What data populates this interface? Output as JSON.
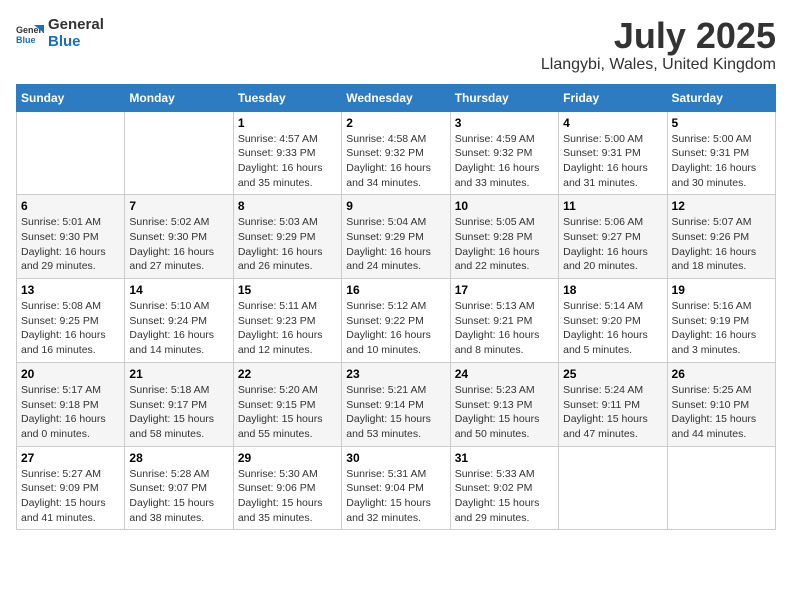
{
  "header": {
    "logo_general": "General",
    "logo_blue": "Blue",
    "main_title": "July 2025",
    "sub_title": "Llangybi, Wales, United Kingdom"
  },
  "weekdays": [
    "Sunday",
    "Monday",
    "Tuesday",
    "Wednesday",
    "Thursday",
    "Friday",
    "Saturday"
  ],
  "weeks": [
    [
      {
        "day": "",
        "detail": ""
      },
      {
        "day": "",
        "detail": ""
      },
      {
        "day": "1",
        "detail": "Sunrise: 4:57 AM\nSunset: 9:33 PM\nDaylight: 16 hours\nand 35 minutes."
      },
      {
        "day": "2",
        "detail": "Sunrise: 4:58 AM\nSunset: 9:32 PM\nDaylight: 16 hours\nand 34 minutes."
      },
      {
        "day": "3",
        "detail": "Sunrise: 4:59 AM\nSunset: 9:32 PM\nDaylight: 16 hours\nand 33 minutes."
      },
      {
        "day": "4",
        "detail": "Sunrise: 5:00 AM\nSunset: 9:31 PM\nDaylight: 16 hours\nand 31 minutes."
      },
      {
        "day": "5",
        "detail": "Sunrise: 5:00 AM\nSunset: 9:31 PM\nDaylight: 16 hours\nand 30 minutes."
      }
    ],
    [
      {
        "day": "6",
        "detail": "Sunrise: 5:01 AM\nSunset: 9:30 PM\nDaylight: 16 hours\nand 29 minutes."
      },
      {
        "day": "7",
        "detail": "Sunrise: 5:02 AM\nSunset: 9:30 PM\nDaylight: 16 hours\nand 27 minutes."
      },
      {
        "day": "8",
        "detail": "Sunrise: 5:03 AM\nSunset: 9:29 PM\nDaylight: 16 hours\nand 26 minutes."
      },
      {
        "day": "9",
        "detail": "Sunrise: 5:04 AM\nSunset: 9:29 PM\nDaylight: 16 hours\nand 24 minutes."
      },
      {
        "day": "10",
        "detail": "Sunrise: 5:05 AM\nSunset: 9:28 PM\nDaylight: 16 hours\nand 22 minutes."
      },
      {
        "day": "11",
        "detail": "Sunrise: 5:06 AM\nSunset: 9:27 PM\nDaylight: 16 hours\nand 20 minutes."
      },
      {
        "day": "12",
        "detail": "Sunrise: 5:07 AM\nSunset: 9:26 PM\nDaylight: 16 hours\nand 18 minutes."
      }
    ],
    [
      {
        "day": "13",
        "detail": "Sunrise: 5:08 AM\nSunset: 9:25 PM\nDaylight: 16 hours\nand 16 minutes."
      },
      {
        "day": "14",
        "detail": "Sunrise: 5:10 AM\nSunset: 9:24 PM\nDaylight: 16 hours\nand 14 minutes."
      },
      {
        "day": "15",
        "detail": "Sunrise: 5:11 AM\nSunset: 9:23 PM\nDaylight: 16 hours\nand 12 minutes."
      },
      {
        "day": "16",
        "detail": "Sunrise: 5:12 AM\nSunset: 9:22 PM\nDaylight: 16 hours\nand 10 minutes."
      },
      {
        "day": "17",
        "detail": "Sunrise: 5:13 AM\nSunset: 9:21 PM\nDaylight: 16 hours\nand 8 minutes."
      },
      {
        "day": "18",
        "detail": "Sunrise: 5:14 AM\nSunset: 9:20 PM\nDaylight: 16 hours\nand 5 minutes."
      },
      {
        "day": "19",
        "detail": "Sunrise: 5:16 AM\nSunset: 9:19 PM\nDaylight: 16 hours\nand 3 minutes."
      }
    ],
    [
      {
        "day": "20",
        "detail": "Sunrise: 5:17 AM\nSunset: 9:18 PM\nDaylight: 16 hours\nand 0 minutes."
      },
      {
        "day": "21",
        "detail": "Sunrise: 5:18 AM\nSunset: 9:17 PM\nDaylight: 15 hours\nand 58 minutes."
      },
      {
        "day": "22",
        "detail": "Sunrise: 5:20 AM\nSunset: 9:15 PM\nDaylight: 15 hours\nand 55 minutes."
      },
      {
        "day": "23",
        "detail": "Sunrise: 5:21 AM\nSunset: 9:14 PM\nDaylight: 15 hours\nand 53 minutes."
      },
      {
        "day": "24",
        "detail": "Sunrise: 5:23 AM\nSunset: 9:13 PM\nDaylight: 15 hours\nand 50 minutes."
      },
      {
        "day": "25",
        "detail": "Sunrise: 5:24 AM\nSunset: 9:11 PM\nDaylight: 15 hours\nand 47 minutes."
      },
      {
        "day": "26",
        "detail": "Sunrise: 5:25 AM\nSunset: 9:10 PM\nDaylight: 15 hours\nand 44 minutes."
      }
    ],
    [
      {
        "day": "27",
        "detail": "Sunrise: 5:27 AM\nSunset: 9:09 PM\nDaylight: 15 hours\nand 41 minutes."
      },
      {
        "day": "28",
        "detail": "Sunrise: 5:28 AM\nSunset: 9:07 PM\nDaylight: 15 hours\nand 38 minutes."
      },
      {
        "day": "29",
        "detail": "Sunrise: 5:30 AM\nSunset: 9:06 PM\nDaylight: 15 hours\nand 35 minutes."
      },
      {
        "day": "30",
        "detail": "Sunrise: 5:31 AM\nSunset: 9:04 PM\nDaylight: 15 hours\nand 32 minutes."
      },
      {
        "day": "31",
        "detail": "Sunrise: 5:33 AM\nSunset: 9:02 PM\nDaylight: 15 hours\nand 29 minutes."
      },
      {
        "day": "",
        "detail": ""
      },
      {
        "day": "",
        "detail": ""
      }
    ]
  ]
}
